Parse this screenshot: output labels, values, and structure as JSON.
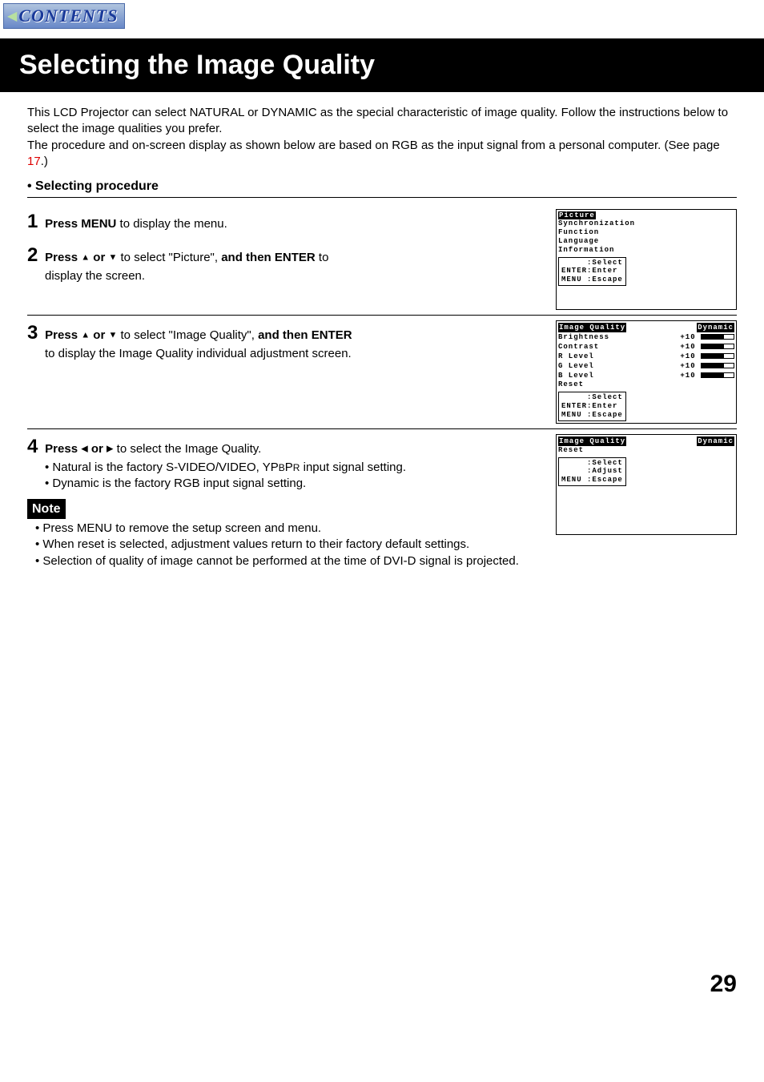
{
  "contents_button": "CONTENTS",
  "title": "Selecting the Image Quality",
  "intro": {
    "p1": "This LCD Projector can select NATURAL or DYNAMIC as the special characteristic of image quality. Follow the instructions below to select the image qualities you prefer.",
    "p2_a": "The procedure and on-screen display as shown below are based on RGB as the input signal from a personal computer. (See page ",
    "p2_link": "17",
    "p2_b": ".)"
  },
  "section_heading": "• Selecting procedure",
  "steps": [
    {
      "num": "1",
      "line1_a": "Press MENU",
      "line1_b": " to display the menu."
    },
    {
      "num": "2",
      "line1_a": "Press ",
      "line1_b": " or ",
      "line1_c": " to select \"Picture\", ",
      "line1_d": "and then ENTER",
      "line1_e": " to",
      "line2": "display the screen."
    },
    {
      "num": "3",
      "line1_a": "Press ",
      "line1_b": " or ",
      "line1_c": " to select \"Image Quality\", ",
      "line1_d": "and then ENTER",
      "line2": "to display the Image Quality individual adjustment screen."
    },
    {
      "num": "4",
      "line1_a": "Press ",
      "line1_b": " or ",
      "line1_c": " to select the ",
      "line1_d": "Image Quality",
      "line1_e": ".",
      "bullet1_a": "• Natural is the factory S-VIDEO/VIDEO, YP",
      "bullet1_b": "B",
      "bullet1_c": "P",
      "bullet1_d": "R",
      "bullet1_e": " input signal setting.",
      "bullet2": "• Dynamic is the factory RGB input signal setting."
    }
  ],
  "osd1": {
    "items": [
      "Picture",
      "Synchronization",
      "Function",
      "Language",
      "Information"
    ],
    "hints": [
      "     :Select",
      "ENTER:Enter",
      "MENU :Escape"
    ]
  },
  "osd2": {
    "header_a": "Image Quality",
    "header_b": "Dynamic",
    "items": [
      {
        "label": "Brightness",
        "val": "+10"
      },
      {
        "label": "Contrast",
        "val": "+10"
      },
      {
        "label": "R Level",
        "val": "+10"
      },
      {
        "label": "G Level",
        "val": "+10"
      },
      {
        "label": "B Level",
        "val": "+10"
      },
      {
        "label": "Reset",
        "val": ""
      }
    ],
    "hints": [
      "     :Select",
      "ENTER:Enter",
      "MENU :Escape"
    ]
  },
  "osd3": {
    "header_a": "Image Quality",
    "header_b": "Dynamic",
    "items": [
      "Reset"
    ],
    "hints": [
      "     :Select",
      "     :Adjust",
      "MENU :Escape"
    ]
  },
  "note_label": "Note",
  "notes": [
    "• Press MENU to remove the setup screen and menu.",
    "• When reset is selected, adjustment values return to their factory default settings.",
    "• Selection of quality of image cannot be performed at the time of DVI-D signal is projected."
  ],
  "page_number": "29"
}
